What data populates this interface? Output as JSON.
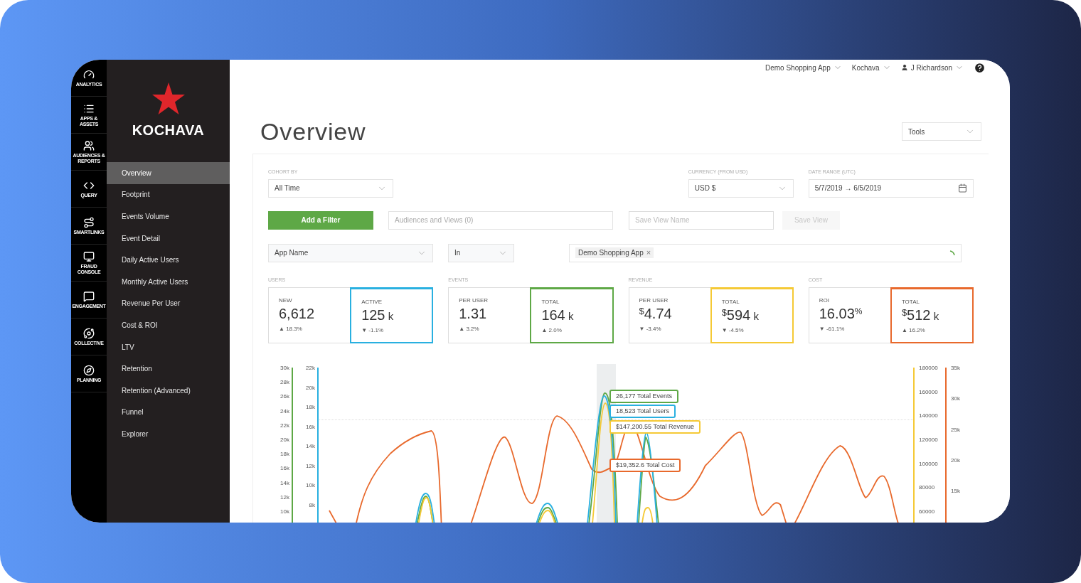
{
  "rail": [
    {
      "label": "ANALYTICS"
    },
    {
      "label": "APPS & ASSETS"
    },
    {
      "label": "AUDIENCES & REPORTS"
    },
    {
      "label": "QUERY"
    },
    {
      "label": "SMARTLINKS"
    },
    {
      "label": "FRAUD CONSOLE"
    },
    {
      "label": "ENGAGEMENT"
    },
    {
      "label": "COLLECTIVE"
    },
    {
      "label": "PLANNING"
    }
  ],
  "logo": {
    "text": "KOCHAVA"
  },
  "nav": [
    {
      "label": "Overview",
      "selected": true
    },
    {
      "label": "Footprint",
      "selected": false
    },
    {
      "label": "Events Volume",
      "selected": false
    },
    {
      "label": "Event Detail",
      "selected": false
    },
    {
      "label": "Daily Active Users",
      "selected": false
    },
    {
      "label": "Monthly Active Users",
      "selected": false
    },
    {
      "label": "Revenue Per User",
      "selected": false
    },
    {
      "label": "Cost & ROI",
      "selected": false
    },
    {
      "label": "LTV",
      "selected": false
    },
    {
      "label": "Retention",
      "selected": false
    },
    {
      "label": "Retention (Advanced)",
      "selected": false
    },
    {
      "label": "Funnel",
      "selected": false
    },
    {
      "label": "Explorer",
      "selected": false
    }
  ],
  "header": {
    "app": "Demo Shopping App",
    "org": "Kochava",
    "user": "J Richardson"
  },
  "title": "Overview",
  "tools": "Tools",
  "filters": {
    "cohort": {
      "label": "COHORT BY",
      "value": "All Time"
    },
    "currency": {
      "label": "CURRENCY (FROM USD)",
      "value": "USD $"
    },
    "date_range": {
      "label": "DATE RANGE (UTC)",
      "value": "5/7/2019 → 6/5/2019"
    }
  },
  "actions": {
    "add_filter": "Add a Filter",
    "audiences": {
      "placeholder": "Audiences and Views (0)"
    },
    "view_name": {
      "placeholder": "Save View Name"
    },
    "save_view": {
      "label": "Save View",
      "disabled": true
    }
  },
  "condition": {
    "field": "App Name",
    "operator": "In",
    "tag": "Demo Shopping App",
    "tag_remove": "×"
  },
  "metric_groups": [
    {
      "title": "USERS",
      "cards": [
        {
          "label": "NEW",
          "value": "6,612",
          "change": "▲ 18.3%",
          "selected": false
        },
        {
          "label": "ACTIVE",
          "value": "125",
          "unit": "k",
          "change": "▼ -1.1%",
          "selected": true,
          "color": "#29b0e0"
        }
      ]
    },
    {
      "title": "EVENTS",
      "cards": [
        {
          "label": "PER USER",
          "value": "1.31",
          "change": "▲ 3.2%",
          "selected": false
        },
        {
          "label": "TOTAL",
          "value": "164",
          "unit": "k",
          "change": "▲ 2.0%",
          "selected": true,
          "color": "#5ea846"
        }
      ]
    },
    {
      "title": "REVENUE",
      "cards": [
        {
          "label": "PER USER",
          "prefix": "$",
          "value": "4.74",
          "change": "▼ -3.4%",
          "selected": false
        },
        {
          "label": "TOTAL",
          "prefix": "$",
          "value": "594",
          "unit": "k",
          "change": "▼ -4.5%",
          "selected": true,
          "color": "#f5c935"
        }
      ]
    },
    {
      "title": "COST",
      "cards": [
        {
          "label": "ROI",
          "value": "16.03",
          "suffix": "%",
          "change": "▼ -61.1%",
          "selected": false
        },
        {
          "label": "TOTAL",
          "prefix": "$",
          "value": "512",
          "unit": "k",
          "change": "▲ 16.2%",
          "selected": true,
          "color": "#e8692c"
        }
      ]
    }
  ],
  "chart": {
    "left_axes": [
      {
        "color": "#5ea846",
        "ticks": [
          "30k",
          "28k",
          "26k",
          "24k",
          "22k",
          "20k",
          "18k",
          "16k",
          "14k",
          "12k",
          "10k"
        ]
      },
      {
        "color": "#29b0e0",
        "ticks": [
          "22k",
          "20k",
          "18k",
          "16k",
          "14k",
          "12k",
          "10k",
          "8k"
        ]
      }
    ],
    "right_axes": [
      {
        "color": "#f5c935",
        "ticks": [
          "180000",
          "160000",
          "140000",
          "120000",
          "100000",
          "80000",
          "60000"
        ]
      },
      {
        "color": "#e8692c",
        "ticks": [
          "35k",
          "30k",
          "25k",
          "20k",
          "15k"
        ]
      }
    ],
    "tooltips": [
      {
        "text": "26,177 Total Events",
        "color": "#5ea846"
      },
      {
        "text": "18,523 Total Users",
        "color": "#29b0e0"
      },
      {
        "text": "$147,200.55 Total Revenue",
        "color": "#f5c935"
      },
      {
        "text": "$19,352.6 Total Cost",
        "color": "#e8692c"
      }
    ]
  }
}
